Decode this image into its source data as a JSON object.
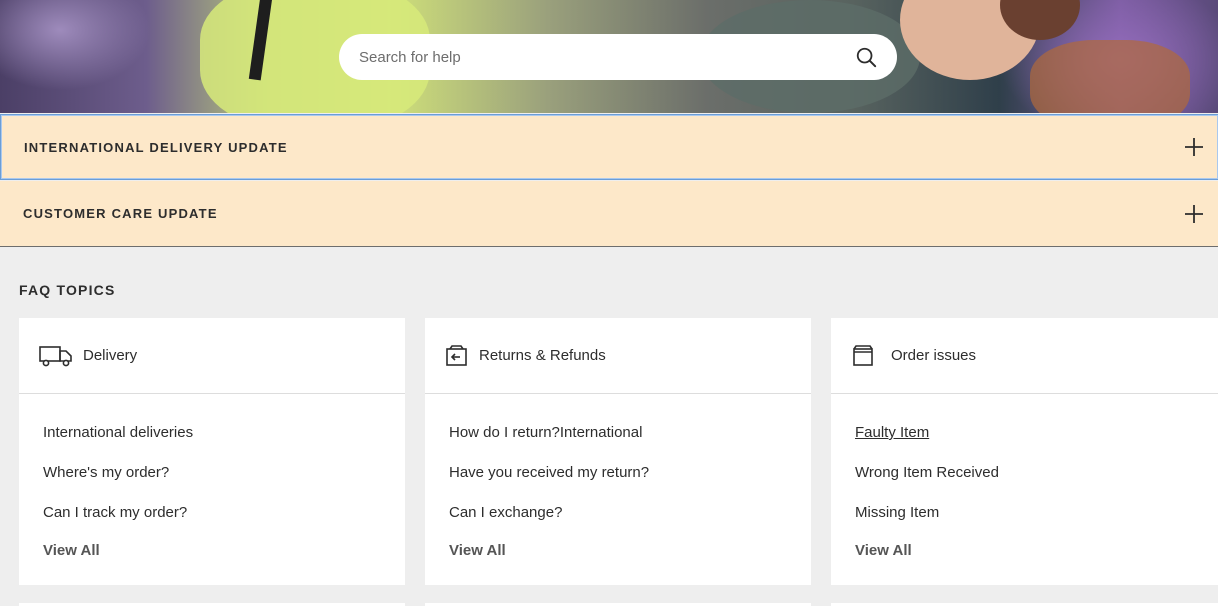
{
  "search": {
    "placeholder": "Search for help"
  },
  "updates": [
    {
      "title": "INTERNATIONAL DELIVERY UPDATE"
    },
    {
      "title": "CUSTOMER CARE UPDATE"
    }
  ],
  "faq": {
    "heading": "FAQ TOPICS",
    "topics": [
      {
        "title": "Delivery",
        "icon": "delivery-truck-icon",
        "links": [
          "International deliveries",
          "Where's my order?",
          "Can I track my order?"
        ],
        "view_all": "View All"
      },
      {
        "title": "Returns & Refunds",
        "icon": "return-box-icon",
        "links": [
          "How do I return?International",
          "Have you received my return?",
          "Can I exchange?"
        ],
        "view_all": "View All"
      },
      {
        "title": "Order issues",
        "icon": "order-box-icon",
        "links": [
          "Faulty Item",
          "Wrong Item Received",
          "Missing Item"
        ],
        "view_all": "View All"
      }
    ]
  }
}
